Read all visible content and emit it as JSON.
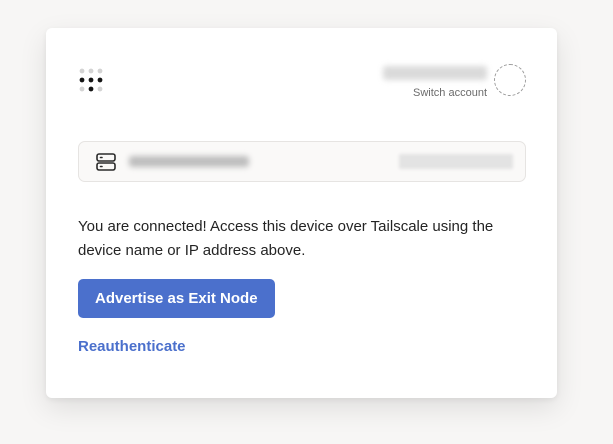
{
  "header": {
    "logo_icon": "tailscale-logo-icon",
    "account": {
      "switch_label": "Switch account",
      "avatar_icon": "avatar-placeholder-icon"
    }
  },
  "device": {
    "icon": "server-icon"
  },
  "message": {
    "text": "You are connected! Access this device over Tailscale using the device name or IP address above."
  },
  "actions": {
    "exit_node_label": "Advertise as Exit Node",
    "reauth_label": "Reauthenticate"
  },
  "colors": {
    "accent": "#4b70cc",
    "text": "#242424",
    "muted": "#6b6b6b",
    "background": "#f7f6f5",
    "card": "#ffffff"
  }
}
